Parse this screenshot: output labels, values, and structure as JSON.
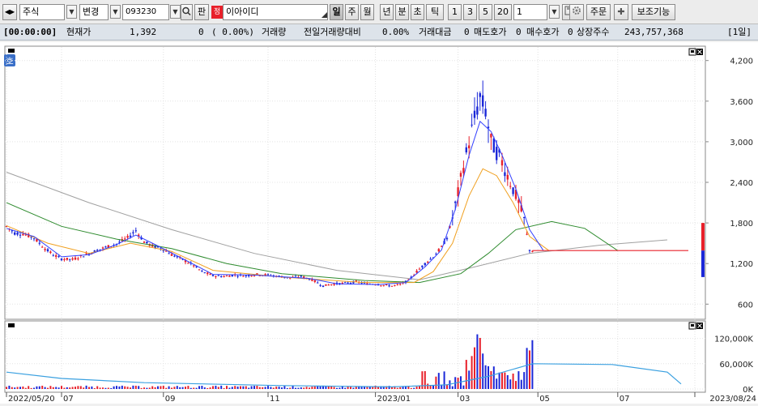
{
  "toolbar": {
    "market_select": "주식",
    "mode_select": "변경",
    "code_input": "093230",
    "search_button_label": "판",
    "stock_badge": "정",
    "stock_name": "이아이디",
    "period_buttons": [
      "일",
      "주",
      "월",
      "년",
      "분",
      "초",
      "틱"
    ],
    "active_period": "일",
    "interval_buttons": [
      "1",
      "3",
      "5",
      "20"
    ],
    "interval_value": "1",
    "order_button": "주문",
    "assist_button": "보조기능"
  },
  "status": {
    "time": "[00:00:00]",
    "price_label": "현재가",
    "price": "1,392",
    "change": "0",
    "change_pct": "( 0.00%)",
    "volume_label": "거래량",
    "prev_volume_label": "전일거래량대비",
    "prev_volume_pct": "0.00%",
    "trade_amount_label": "거래대금",
    "trade_amount": "0",
    "ask_label": "매도호가",
    "ask": "0",
    "bid_label": "매수호가",
    "bid": "0",
    "shares_label": "상장주수",
    "shares": "243,757,368",
    "period_badge": "[1일]"
  },
  "chart_data": {
    "type": "candlestick",
    "price_axis_labels": [
      "4,200",
      "3,600",
      "3,000",
      "2,400",
      "1,800",
      "1,200",
      "600"
    ],
    "ylim": [
      400,
      4400
    ],
    "volume_axis_labels": [
      "120,000K",
      "60,000K",
      "0K"
    ],
    "date_labels": [
      "2022/05/20",
      "07",
      "09",
      "11",
      "2023/01",
      "03",
      "05",
      "07",
      "2023/08/24"
    ],
    "side_badge": "호",
    "colors": {
      "up": "#e8202a",
      "down": "#1b28d8",
      "ma5": "#3340ff",
      "ma20": "#f0a020",
      "ma60": "#2e8b2e",
      "ma120": "#a0a0a0",
      "volume_ma": "#3aa0e0"
    },
    "price_path": [
      [
        0,
        1750
      ],
      [
        3,
        1650
      ],
      [
        6,
        1640
      ],
      [
        10,
        1580
      ],
      [
        14,
        1420
      ],
      [
        17,
        1330
      ],
      [
        20,
        1270
      ],
      [
        24,
        1260
      ],
      [
        28,
        1320
      ],
      [
        32,
        1380
      ],
      [
        36,
        1440
      ],
      [
        40,
        1490
      ],
      [
        44,
        1580
      ],
      [
        47,
        1690
      ],
      [
        50,
        1520
      ],
      [
        53,
        1460
      ],
      [
        57,
        1410
      ],
      [
        60,
        1330
      ],
      [
        64,
        1260
      ],
      [
        68,
        1170
      ],
      [
        71,
        1080
      ],
      [
        75,
        1020
      ],
      [
        79,
        1010
      ],
      [
        83,
        1030
      ],
      [
        87,
        1020
      ],
      [
        91,
        1040
      ],
      [
        95,
        1030
      ],
      [
        99,
        1010
      ],
      [
        103,
        990
      ],
      [
        107,
        1010
      ],
      [
        111,
        960
      ],
      [
        115,
        870
      ],
      [
        119,
        900
      ],
      [
        123,
        910
      ],
      [
        127,
        930
      ],
      [
        131,
        900
      ],
      [
        134,
        900
      ],
      [
        137,
        880
      ],
      [
        140,
        870
      ],
      [
        143,
        890
      ],
      [
        146,
        950
      ],
      [
        149,
        1080
      ],
      [
        152,
        1200
      ],
      [
        155,
        1300
      ],
      [
        158,
        1440
      ],
      [
        160,
        1580
      ],
      [
        162,
        1880
      ],
      [
        164,
        2240
      ],
      [
        166,
        2650
      ],
      [
        168,
        3000
      ],
      [
        170,
        3350
      ],
      [
        172,
        3650
      ],
      [
        174,
        3450
      ],
      [
        176,
        3000
      ],
      [
        178,
        2850
      ],
      [
        180,
        2700
      ],
      [
        182,
        2500
      ],
      [
        184,
        2300
      ],
      [
        186,
        2100
      ],
      [
        188,
        1850
      ],
      [
        190,
        1400
      ],
      [
        191,
        1392
      ]
    ],
    "ma5": [
      [
        0,
        1720
      ],
      [
        10,
        1600
      ],
      [
        20,
        1300
      ],
      [
        30,
        1330
      ],
      [
        40,
        1480
      ],
      [
        47,
        1620
      ],
      [
        55,
        1460
      ],
      [
        65,
        1250
      ],
      [
        75,
        1040
      ],
      [
        90,
        1030
      ],
      [
        110,
        980
      ],
      [
        120,
        900
      ],
      [
        135,
        890
      ],
      [
        145,
        920
      ],
      [
        152,
        1150
      ],
      [
        158,
        1400
      ],
      [
        163,
        2000
      ],
      [
        168,
        2800
      ],
      [
        172,
        3300
      ],
      [
        176,
        3150
      ],
      [
        180,
        2800
      ],
      [
        185,
        2300
      ],
      [
        190,
        1700
      ],
      [
        195,
        1392
      ]
    ],
    "ma20": [
      [
        0,
        1760
      ],
      [
        15,
        1500
      ],
      [
        30,
        1350
      ],
      [
        45,
        1500
      ],
      [
        60,
        1380
      ],
      [
        75,
        1100
      ],
      [
        100,
        1000
      ],
      [
        130,
        920
      ],
      [
        148,
        920
      ],
      [
        155,
        1080
      ],
      [
        162,
        1500
      ],
      [
        168,
        2200
      ],
      [
        173,
        2600
      ],
      [
        178,
        2500
      ],
      [
        184,
        2100
      ],
      [
        190,
        1600
      ],
      [
        197,
        1392
      ]
    ],
    "ma60": [
      [
        0,
        2100
      ],
      [
        20,
        1750
      ],
      [
        40,
        1560
      ],
      [
        60,
        1420
      ],
      [
        80,
        1200
      ],
      [
        100,
        1050
      ],
      [
        130,
        950
      ],
      [
        150,
        920
      ],
      [
        165,
        1050
      ],
      [
        175,
        1350
      ],
      [
        185,
        1700
      ],
      [
        198,
        1820
      ],
      [
        210,
        1720
      ],
      [
        222,
        1392
      ]
    ],
    "ma120": [
      [
        0,
        2550
      ],
      [
        30,
        2100
      ],
      [
        60,
        1700
      ],
      [
        90,
        1350
      ],
      [
        120,
        1100
      ],
      [
        150,
        960
      ],
      [
        170,
        1150
      ],
      [
        190,
        1350
      ],
      [
        215,
        1470
      ],
      [
        240,
        1550
      ]
    ],
    "volume_bars_k": [
      [
        150,
        8000
      ],
      [
        158,
        12000
      ],
      [
        164,
        35000
      ],
      [
        168,
        70000
      ],
      [
        170,
        110000
      ],
      [
        172,
        140000
      ],
      [
        174,
        90000
      ],
      [
        176,
        60000
      ],
      [
        180,
        45000
      ],
      [
        184,
        30000
      ],
      [
        188,
        25000
      ],
      [
        190,
        130000
      ]
    ],
    "volume_ma_k": [
      [
        0,
        40000
      ],
      [
        20,
        25000
      ],
      [
        50,
        15000
      ],
      [
        100,
        8000
      ],
      [
        140,
        5000
      ],
      [
        160,
        10000
      ],
      [
        175,
        30000
      ],
      [
        191,
        60000
      ],
      [
        220,
        58000
      ],
      [
        240,
        40000
      ],
      [
        245,
        12000
      ]
    ]
  }
}
